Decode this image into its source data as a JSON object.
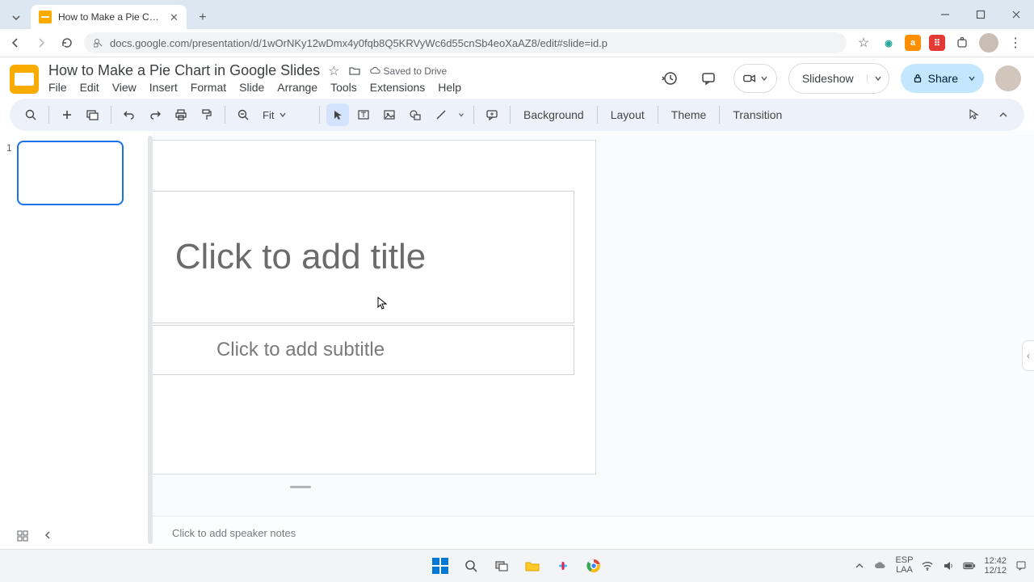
{
  "browser": {
    "tab_title": "How to Make a Pie Chart in Go...",
    "url": "docs.google.com/presentation/d/1wOrNKy12wDmx4y0fqb8Q5KRVyWc6d55cnSb4eoXaAZ8/edit#slide=id.p"
  },
  "doc": {
    "title": "How to Make a Pie Chart in Google Slides",
    "saved": "Saved to Drive"
  },
  "menus": [
    "File",
    "Edit",
    "View",
    "Insert",
    "Format",
    "Slide",
    "Arrange",
    "Tools",
    "Extensions",
    "Help"
  ],
  "toolbar": {
    "zoom": "Fit",
    "background": "Background",
    "layout": "Layout",
    "theme": "Theme",
    "transition": "Transition"
  },
  "header": {
    "slideshow": "Slideshow",
    "share": "Share"
  },
  "slide": {
    "number": "1",
    "title_placeholder": "Click to add title",
    "subtitle_placeholder": "Click to add subtitle",
    "notes_placeholder": "Click to add speaker notes"
  },
  "taskbar": {
    "lang1": "ESP",
    "lang2": "LAA",
    "time": "12:42",
    "date": "12/12"
  }
}
